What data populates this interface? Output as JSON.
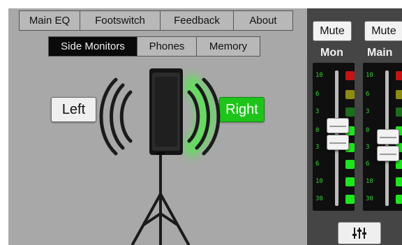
{
  "tabs": [
    {
      "label": "Main EQ",
      "width": 88
    },
    {
      "label": "Footswitch",
      "width": 116
    },
    {
      "label": "Feedback",
      "width": 106
    },
    {
      "label": "About",
      "width": 86
    }
  ],
  "subtabs": [
    {
      "label": "Side Monitors",
      "active": true,
      "width": 128
    },
    {
      "label": "Phones",
      "active": false,
      "width": 86
    },
    {
      "label": "Memory",
      "active": false,
      "width": 92
    }
  ],
  "monitor": {
    "left_label": "Left",
    "right_label": "Right",
    "selected_side": "Right"
  },
  "mixer": {
    "mute_label": "Mute",
    "channels": [
      {
        "name": "Mon",
        "level_fraction": 0.58
      },
      {
        "name": "Main",
        "level_fraction": 0.5
      }
    ],
    "scale_labels": [
      "10",
      "6",
      "3",
      "0",
      "3",
      "6",
      "10",
      "30"
    ],
    "led_colors": [
      "#c41414",
      "#8d8b12",
      "#1c6d1c",
      "#1ee61e",
      "#1ee61e",
      "#1ee61e",
      "#1ee61e",
      "#1ee61e"
    ],
    "settings_icon": "mixer-sliders-icon"
  },
  "colors": {
    "active_green": "#1fc41a",
    "panel_gray": "#a8a8a8",
    "mixer_bg": "#454545"
  }
}
